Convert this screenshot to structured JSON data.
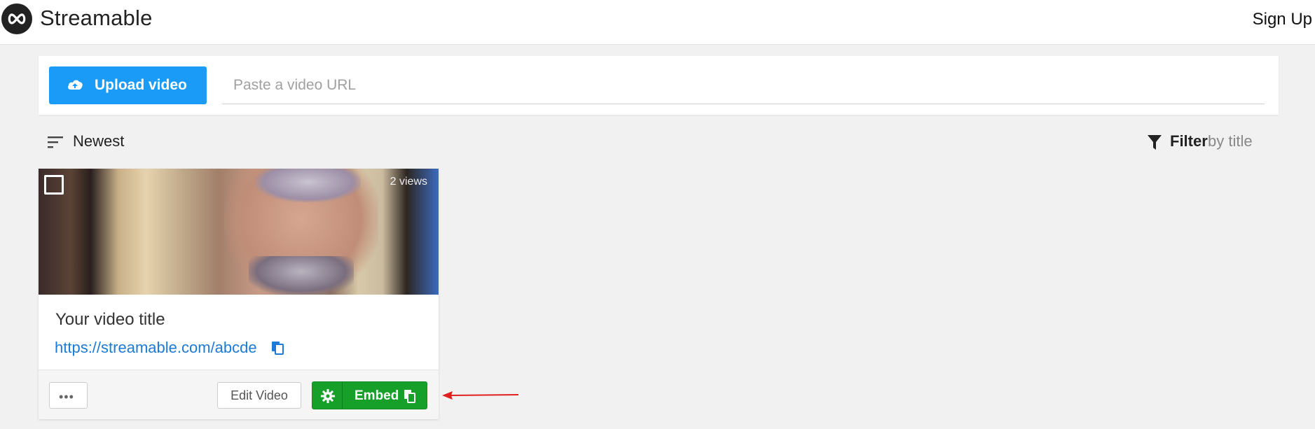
{
  "header": {
    "brand": "Streamable",
    "signup_label": "Sign Up"
  },
  "upload": {
    "button_label": "Upload video",
    "url_placeholder": "Paste a video URL"
  },
  "toolbar": {
    "sort_label": "Newest",
    "filter_bold": "Filter",
    "filter_rest": "by title"
  },
  "video": {
    "views": "2 views",
    "title": "Your video title",
    "link": "https://streamable.com/abcde",
    "more_label": "•••",
    "edit_label": "Edit Video",
    "embed_label": "Embed"
  },
  "colors": {
    "upload_blue": "#1a9bf7",
    "embed_green": "#16a02a",
    "link_blue": "#1d7ad6",
    "annotation_red": "#e02020"
  }
}
